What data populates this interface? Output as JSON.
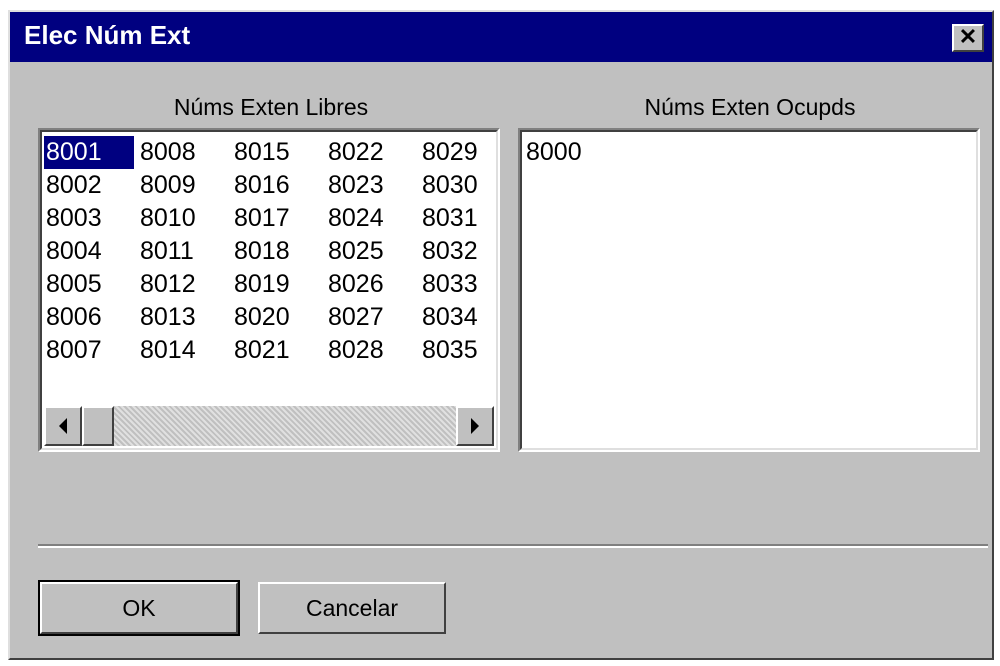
{
  "window": {
    "title": "Elec Núm Ext",
    "close_glyph": "✕"
  },
  "free_list": {
    "label": "Núms Exten Libres",
    "selected": "8001",
    "columns": [
      [
        "8001",
        "8002",
        "8003",
        "8004",
        "8005",
        "8006",
        "8007"
      ],
      [
        "8008",
        "8009",
        "8010",
        "8011",
        "8012",
        "8013",
        "8014"
      ],
      [
        "8015",
        "8016",
        "8017",
        "8018",
        "8019",
        "8020",
        "8021"
      ],
      [
        "8022",
        "8023",
        "8024",
        "8025",
        "8026",
        "8027",
        "8028"
      ],
      [
        "8029",
        "8030",
        "8031",
        "8032",
        "8033",
        "8034",
        "8035"
      ]
    ]
  },
  "used_list": {
    "label": "Núms Exten Ocupds",
    "items": [
      "8000"
    ]
  },
  "buttons": {
    "ok": "OK",
    "cancel": "Cancelar"
  }
}
